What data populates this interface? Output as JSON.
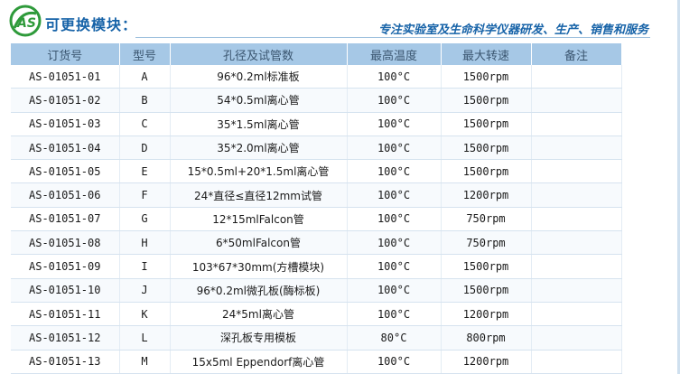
{
  "header": {
    "title": "可更换模块：",
    "slogan": "专注实验室及生命科学仪器研发、生产、销售和服务",
    "logo_icon": "as-logo-icon",
    "brand_color": "#1763a8",
    "logo_color": "#2e9a3a"
  },
  "table": {
    "columns": [
      "订货号",
      "型号",
      "孔径及试管数",
      "最高温度",
      "最大转速",
      "备注"
    ],
    "rows": [
      [
        "AS-01051-01",
        "A",
        "96*0.2ml标准板",
        "100°C",
        "1500rpm",
        ""
      ],
      [
        "AS-01051-02",
        "B",
        "54*0.5ml离心管",
        "100°C",
        "1500rpm",
        ""
      ],
      [
        "AS-01051-03",
        "C",
        "35*1.5ml离心管",
        "100°C",
        "1500rpm",
        ""
      ],
      [
        "AS-01051-04",
        "D",
        "35*2.0ml离心管",
        "100°C",
        "1500rpm",
        ""
      ],
      [
        "AS-01051-05",
        "E",
        "15*0.5ml+20*1.5ml离心管",
        "100°C",
        "1500rpm",
        ""
      ],
      [
        "AS-01051-06",
        "F",
        "24*直径≤直径12mm试管",
        "100°C",
        "1200rpm",
        ""
      ],
      [
        "AS-01051-07",
        "G",
        "12*15mlFalcon管",
        "100°C",
        "750rpm",
        ""
      ],
      [
        "AS-01051-08",
        "H",
        "6*50mlFalcon管",
        "100°C",
        "750rpm",
        ""
      ],
      [
        "AS-01051-09",
        "I",
        "103*67*30mm(方槽模块)",
        "100°C",
        "1500rpm",
        ""
      ],
      [
        "AS-01051-10",
        "J",
        "96*0.2ml微孔板(酶标板)",
        "100°C",
        "1500rpm",
        ""
      ],
      [
        "AS-01051-11",
        "K",
        "24*5ml离心管",
        "100°C",
        "1200rpm",
        ""
      ],
      [
        "AS-01051-12",
        "L",
        "深孔板专用模板",
        "80°C",
        "800rpm",
        ""
      ],
      [
        "AS-01051-13",
        "M",
        "15x5ml Eppendorf离心管",
        "100°C",
        "1200rpm",
        ""
      ]
    ]
  }
}
